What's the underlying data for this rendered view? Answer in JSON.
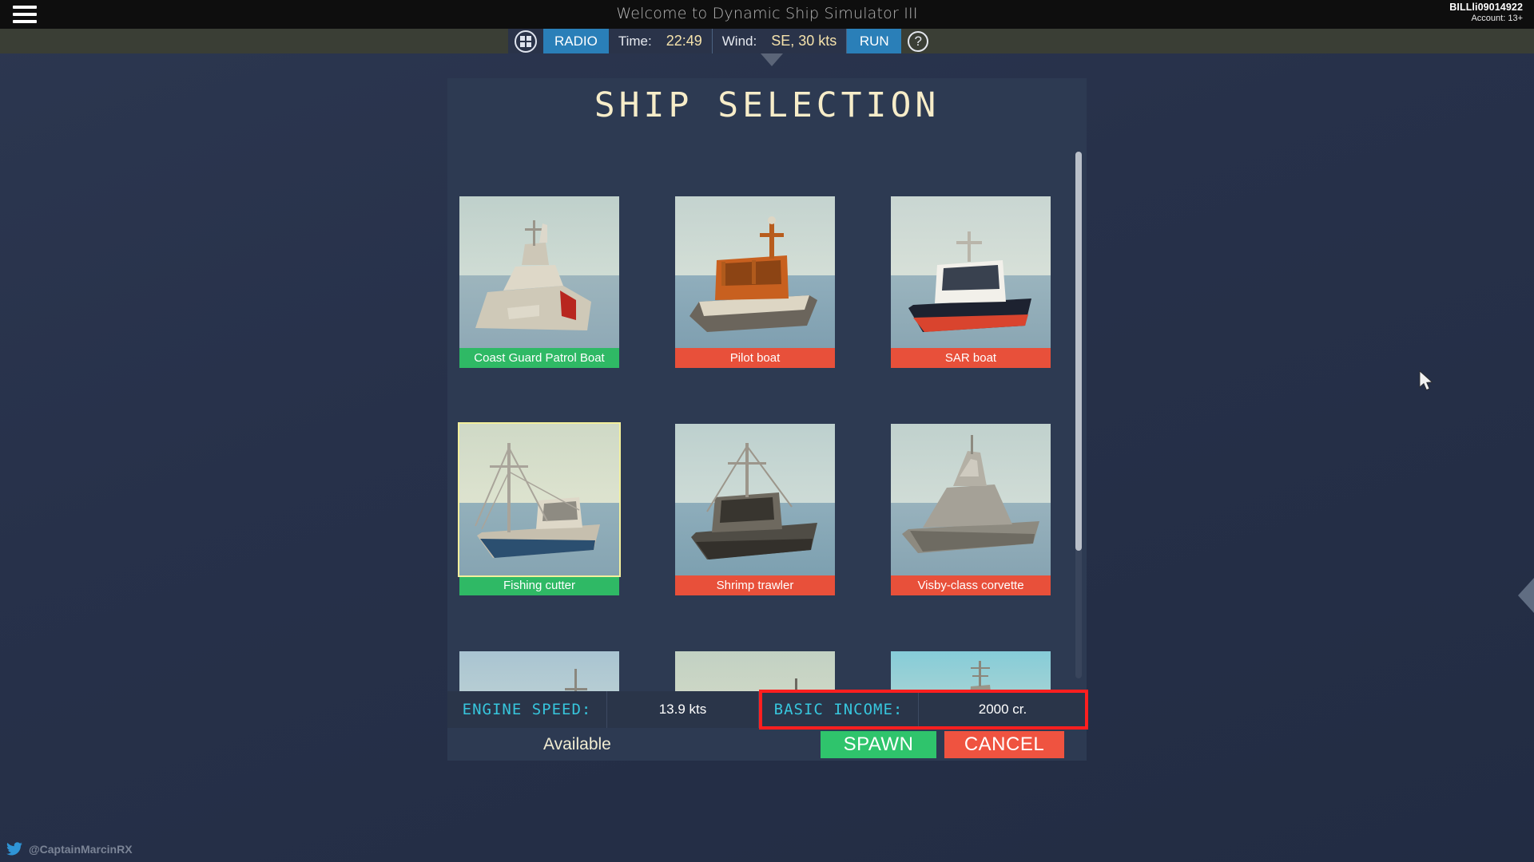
{
  "roblox_bar": {
    "menu_icon": "hamburger-icon",
    "game_title": "Welcome to Dynamic Ship Simulator III",
    "account_name": "BILLli09014922",
    "account_age": "Account: 13+"
  },
  "hud": {
    "grid_icon": "grid-icon",
    "radio_label": "RADIO",
    "time_label": "Time:",
    "time_value": "22:49",
    "wind_label": "Wind:",
    "wind_value": "SE, 30 kts",
    "run_label": "RUN",
    "help_icon": "question-mark-icon",
    "accent_blue": "#2a7fb8",
    "value_color": "#f6e3ac"
  },
  "panel": {
    "title": "SHIP SELECTION",
    "title_color": "#f7edc9",
    "ships": [
      {
        "name": "Coast Guard Patrol Boat",
        "status": "available",
        "selected": false,
        "thumb": "t1"
      },
      {
        "name": "Pilot boat",
        "status": "locked",
        "selected": false,
        "thumb": "t2"
      },
      {
        "name": "SAR boat",
        "status": "locked",
        "selected": false,
        "thumb": "t3"
      },
      {
        "name": "Fishing cutter",
        "status": "available",
        "selected": true,
        "thumb": "t4"
      },
      {
        "name": "Shrimp trawler",
        "status": "locked",
        "selected": false,
        "thumb": "t5"
      },
      {
        "name": "Visby-class corvette",
        "status": "locked",
        "selected": false,
        "thumb": "t6"
      },
      {
        "name": "",
        "status": "none",
        "selected": false,
        "thumb": "t7"
      },
      {
        "name": "",
        "status": "none",
        "selected": false,
        "thumb": "t8"
      },
      {
        "name": "",
        "status": "none",
        "selected": false,
        "thumb": "t9"
      }
    ],
    "available_color": "#2fb965",
    "locked_color": "#e8503a",
    "selected_outline": "#f2ef9d"
  },
  "info_bar": {
    "engine_speed_label": "ENGINE SPEED:",
    "engine_speed_value": "13.9 kts",
    "basic_income_label": "BASIC INCOME:",
    "basic_income_value": "2000 cr.",
    "key_color": "#37c6dd",
    "highlight_color": "#ff1f1f"
  },
  "actions": {
    "availability": "Available",
    "spawn_label": "SPAWN",
    "cancel_label": "CANCEL",
    "spawn_color": "#2fc46c",
    "cancel_color": "#ef5340"
  },
  "overlay": {
    "twitter_handle": "@CaptainMarcinRX",
    "side_arrow_icon": "chevron-left-icon",
    "cursor_icon": "mouse-cursor-icon"
  }
}
